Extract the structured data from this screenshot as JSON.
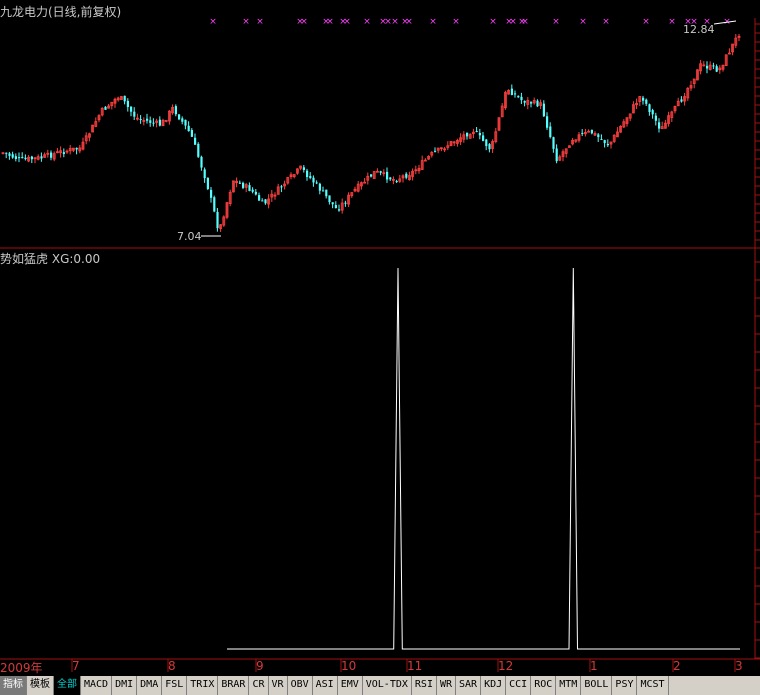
{
  "window": {
    "title": "九龙电力(日线,前复权)",
    "indicator_title": "势如猛虎",
    "indicator_value": "XG:0.00"
  },
  "price_labels": {
    "high": "12.84",
    "low": "7.04"
  },
  "colors": {
    "up": "#ff4040",
    "down": "#54ffff",
    "signal": "#ff40ff",
    "grid": "#a01010",
    "indicator_line": "#ffffff"
  },
  "x_axis": {
    "labels": [
      "2009年",
      "7",
      "8",
      "9",
      "10",
      "11",
      "12",
      "1",
      "2",
      "3"
    ]
  },
  "chart_data": {
    "type": "line",
    "y_axis_printed": false,
    "series": [
      {
        "values": [
          0,
          0,
          0,
          0,
          0,
          0,
          0,
          0,
          0,
          0,
          0,
          0,
          0,
          0,
          0,
          0,
          0,
          0,
          0,
          0,
          0,
          0,
          0,
          0,
          0,
          0,
          0,
          0,
          0,
          0,
          0,
          0,
          0,
          0,
          0,
          0,
          0,
          0,
          0,
          0,
          1,
          0,
          0,
          0,
          0,
          0,
          0,
          0,
          0,
          0,
          0,
          0,
          0,
          0,
          0,
          0,
          0,
          0,
          0,
          0,
          0,
          0,
          0,
          0,
          0,
          0,
          0,
          0,
          0,
          0,
          0,
          0,
          0,
          0,
          0,
          0,
          0,
          0,
          0,
          0,
          0,
          1,
          0,
          0,
          0,
          0,
          0,
          0,
          0,
          0,
          0,
          0,
          0,
          0,
          0,
          0,
          0,
          0,
          0,
          0,
          0,
          0,
          0,
          0,
          0,
          0,
          0,
          0,
          0,
          0,
          0,
          0,
          0,
          0,
          0,
          0,
          0,
          0,
          0,
          0,
          0
        ]
      }
    ]
  },
  "tabs": [
    {
      "label": "指标",
      "state": "sel"
    },
    {
      "label": "模板",
      "state": ""
    },
    {
      "label": "全部",
      "state": "active"
    },
    {
      "label": "MACD",
      "state": ""
    },
    {
      "label": "DMI",
      "state": ""
    },
    {
      "label": "DMA",
      "state": ""
    },
    {
      "label": "FSL",
      "state": ""
    },
    {
      "label": "TRIX",
      "state": ""
    },
    {
      "label": "BRAR",
      "state": ""
    },
    {
      "label": "CR",
      "state": ""
    },
    {
      "label": "VR",
      "state": ""
    },
    {
      "label": "OBV",
      "state": ""
    },
    {
      "label": "ASI",
      "state": ""
    },
    {
      "label": "EMV",
      "state": ""
    },
    {
      "label": "VOL-TDX",
      "state": ""
    },
    {
      "label": "RSI",
      "state": ""
    },
    {
      "label": "WR",
      "state": ""
    },
    {
      "label": "SAR",
      "state": ""
    },
    {
      "label": "KDJ",
      "state": ""
    },
    {
      "label": "CCI",
      "state": ""
    },
    {
      "label": "ROC",
      "state": ""
    },
    {
      "label": "MTM",
      "state": ""
    },
    {
      "label": "BOLL",
      "state": ""
    },
    {
      "label": "PSY",
      "state": ""
    },
    {
      "label": "MCST",
      "state": ""
    }
  ]
}
